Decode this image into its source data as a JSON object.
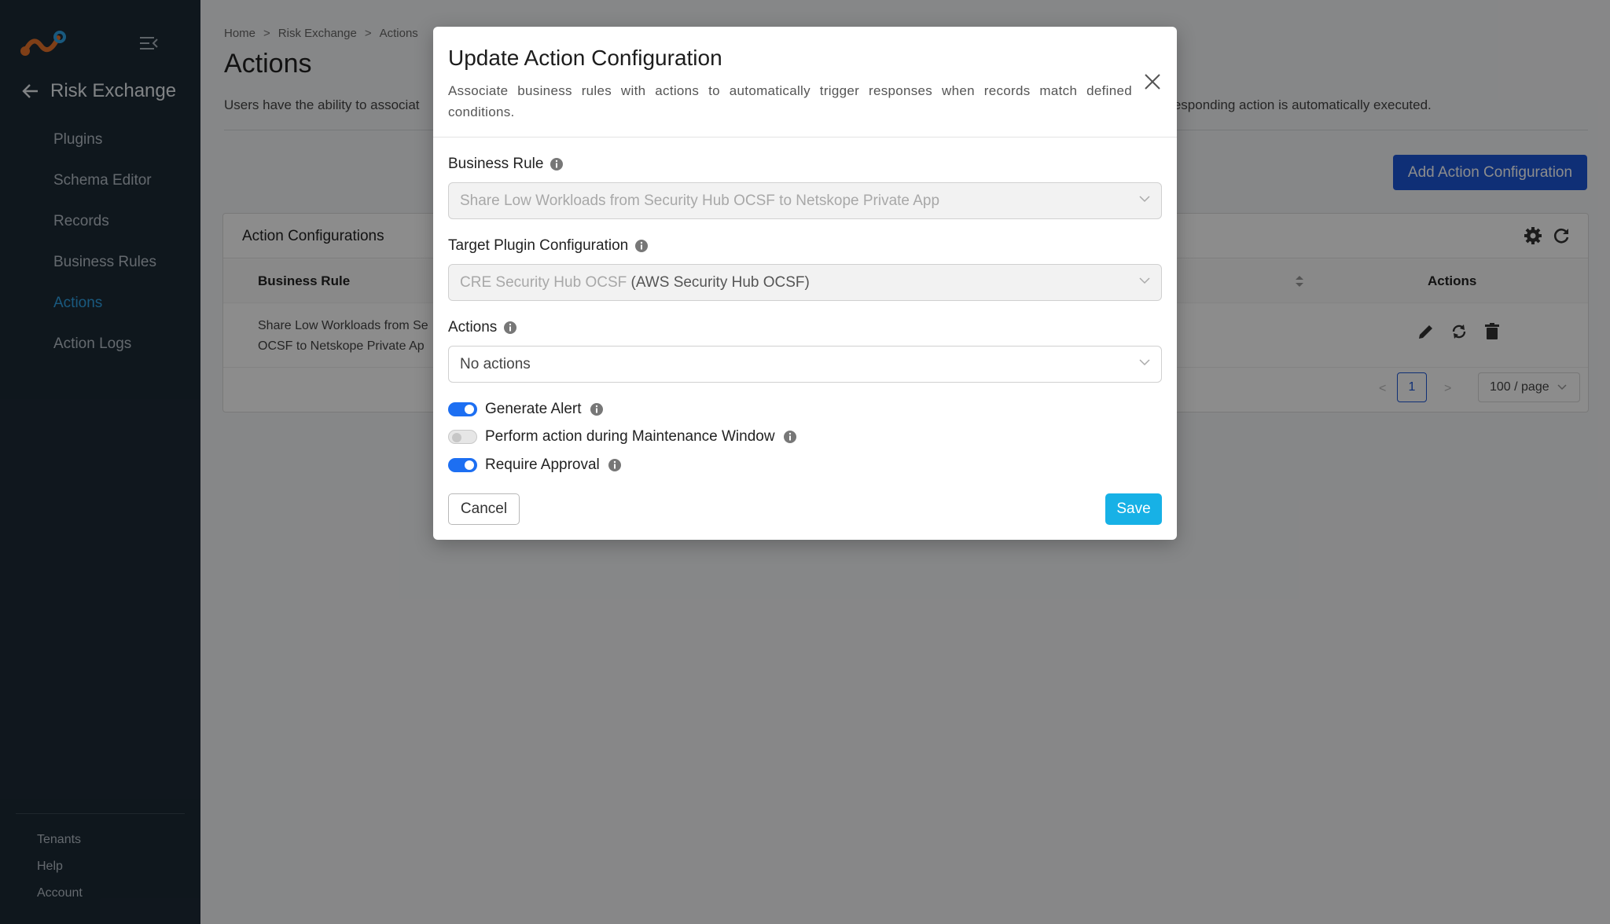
{
  "sidebar": {
    "module_title": "Risk Exchange",
    "items": [
      {
        "label": "Plugins"
      },
      {
        "label": "Schema Editor"
      },
      {
        "label": "Records"
      },
      {
        "label": "Business Rules"
      },
      {
        "label": "Actions"
      },
      {
        "label": "Action Logs"
      }
    ],
    "active_item": "Actions",
    "footer_items": [
      {
        "label": "Tenants"
      },
      {
        "label": "Help"
      },
      {
        "label": "Account"
      }
    ]
  },
  "breadcrumb": {
    "home": "Home",
    "section": "Risk Exchange",
    "current": "Actions",
    "separator": ">"
  },
  "page": {
    "title": "Actions",
    "description_left": "Users have the ability to associat",
    "description_right": "rresponding action is automatically executed.",
    "add_button_label": "Add Action Configuration"
  },
  "table": {
    "card_title": "Action Configurations",
    "columns": {
      "business_rule": "Business Rule",
      "actions": "Actions"
    },
    "rows": [
      {
        "business_rule_line1": "Share Low Workloads from Se",
        "business_rule_line2": "OCSF to Netskope Private Ap"
      }
    ],
    "pagination": {
      "prev": "<",
      "current_page": "1",
      "next": ">",
      "page_size": "100 / page"
    }
  },
  "modal": {
    "title": "Update Action Configuration",
    "description": "Associate business rules with actions to automatically trigger responses when records match defined conditions.",
    "business_rule": {
      "label": "Business Rule",
      "value": "Share Low Workloads from Security Hub OCSF to Netskope Private App"
    },
    "target_plugin": {
      "label": "Target Plugin Configuration",
      "value_name": "CRE Security Hub OCSF",
      "value_type": "(AWS Security Hub OCSF)"
    },
    "actions_field": {
      "label": "Actions",
      "value": "No actions"
    },
    "toggles": [
      {
        "label": "Generate Alert",
        "on": true
      },
      {
        "label": "Perform action during Maintenance Window",
        "on": false
      },
      {
        "label": "Require Approval",
        "on": true
      }
    ],
    "cancel_label": "Cancel",
    "save_label": "Save"
  },
  "colors": {
    "sidebar_bg": "#1d2a36",
    "active_nav": "#2fa3e6",
    "primary_button": "#1d57d8",
    "save_button": "#17b1e6",
    "toggle_on": "#1d6ff2"
  }
}
